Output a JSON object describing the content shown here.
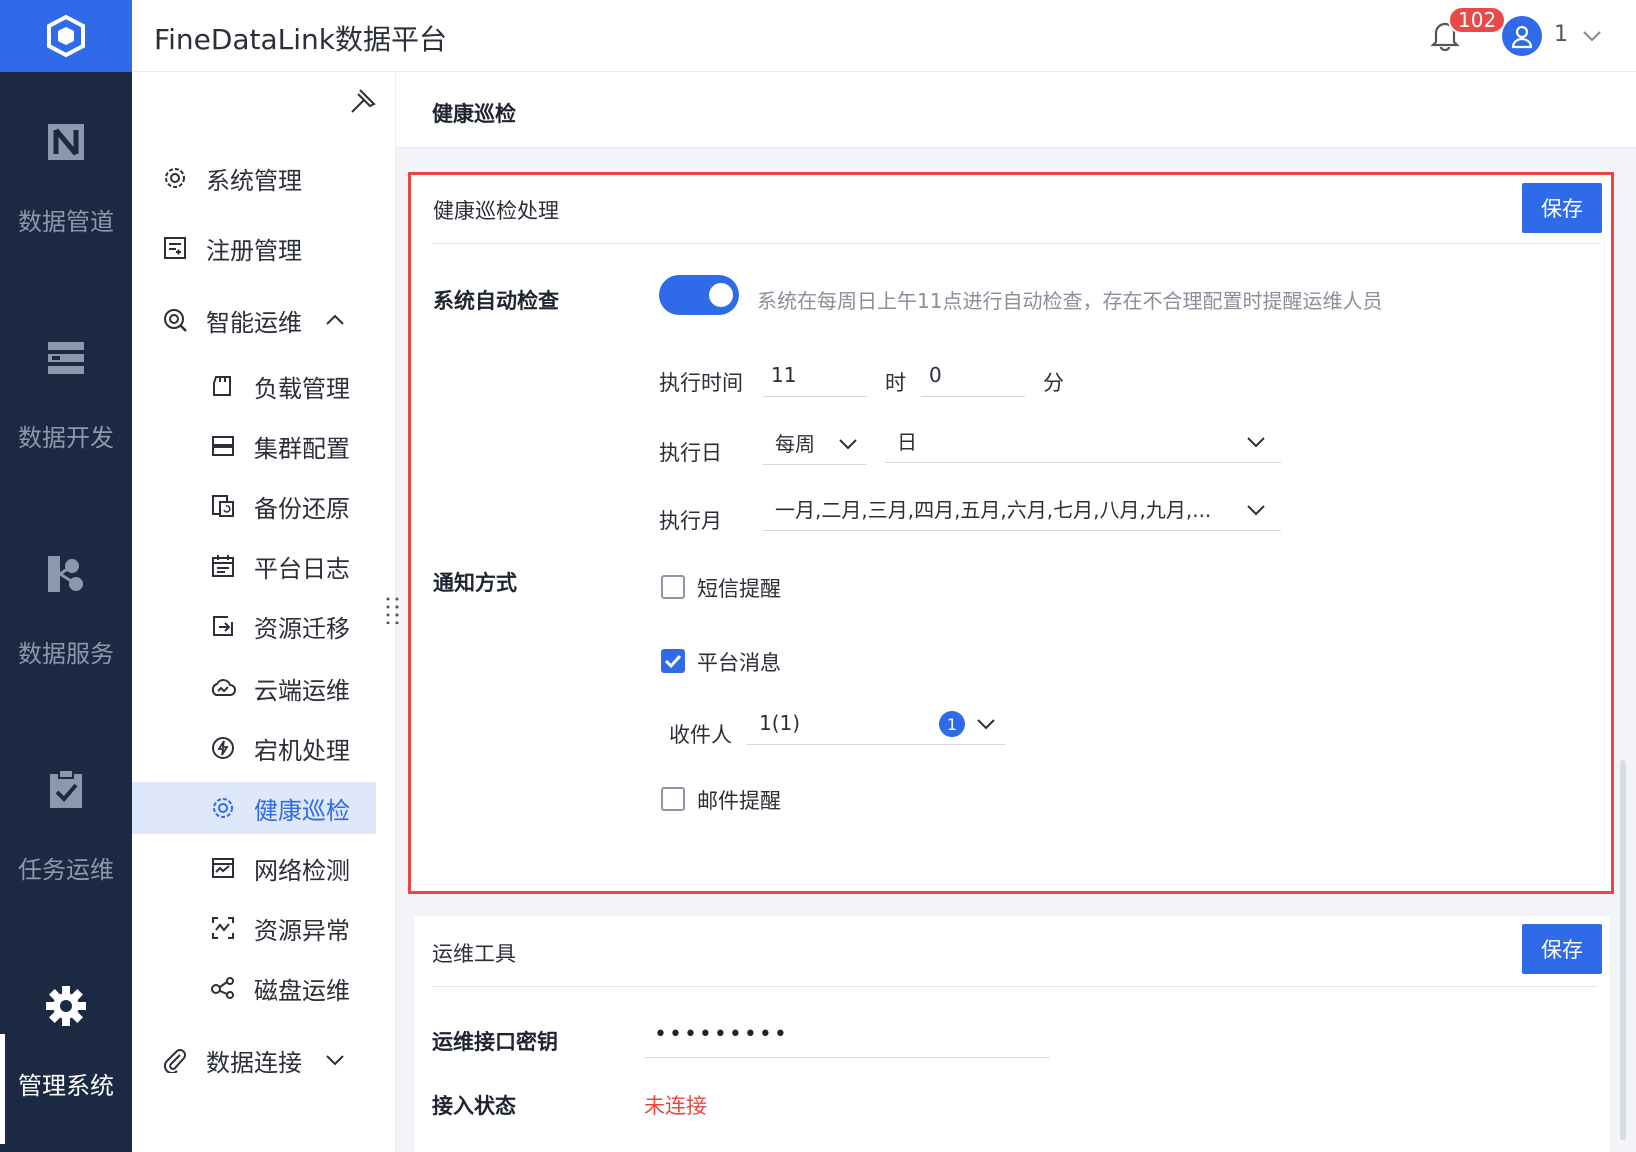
{
  "app": {
    "title": "FineDataLink数据平台"
  },
  "header": {
    "notification_count": "102",
    "user_name": "1"
  },
  "rail": {
    "items": [
      {
        "label": "数据管道",
        "icon": "pipeline-icon"
      },
      {
        "label": "数据开发",
        "icon": "dev-icon"
      },
      {
        "label": "数据服务",
        "icon": "service-icon"
      },
      {
        "label": "任务运维",
        "icon": "task-ops-icon"
      },
      {
        "label": "管理系统",
        "icon": "gear-icon"
      }
    ]
  },
  "sidebar": {
    "groups": [
      {
        "label": "系统管理"
      },
      {
        "label": "注册管理"
      },
      {
        "label": "智能运维"
      }
    ],
    "sub_items": [
      {
        "label": "负载管理"
      },
      {
        "label": "集群配置"
      },
      {
        "label": "备份还原"
      },
      {
        "label": "平台日志"
      },
      {
        "label": "资源迁移"
      },
      {
        "label": "云端运维"
      },
      {
        "label": "宕机处理"
      },
      {
        "label": "健康巡检"
      },
      {
        "label": "网络检测"
      },
      {
        "label": "资源异常"
      },
      {
        "label": "磁盘运维"
      }
    ],
    "bottom_group": {
      "label": "数据连接"
    }
  },
  "page": {
    "breadcrumb": "健康巡检"
  },
  "health_check": {
    "title": "健康巡检处理",
    "save_label": "保存",
    "auto_check_label": "系统自动检查",
    "auto_check_enabled": true,
    "auto_check_hint": "系统在每周日上午11点进行自动检查，存在不合理配置时提醒运维人员",
    "exec_time_label": "执行时间",
    "hour_value": "11",
    "hour_unit": "时",
    "minute_value": "0",
    "minute_unit": "分",
    "exec_day_label": "执行日",
    "day_period": "每周",
    "day_value": "日",
    "exec_month_label": "执行月",
    "month_value": "一月,二月,三月,四月,五月,六月,七月,八月,九月,...",
    "notify_label": "通知方式",
    "sms_label": "短信提醒",
    "sms_checked": false,
    "platform_msg_label": "平台消息",
    "platform_msg_checked": true,
    "recipient_label": "收件人",
    "recipient_value": "1(1)",
    "recipient_count": "1",
    "email_label": "邮件提醒",
    "email_checked": false
  },
  "ops_tools": {
    "title": "运维工具",
    "save_label": "保存",
    "key_label": "运维接口密钥",
    "key_value": "•••••••••",
    "status_label": "接入状态",
    "status_value": "未连接"
  },
  "colors": {
    "accent": "#2f6be8",
    "rail_bg": "#1b2942",
    "highlight_border": "#e8473f",
    "error": "#e8473f"
  }
}
